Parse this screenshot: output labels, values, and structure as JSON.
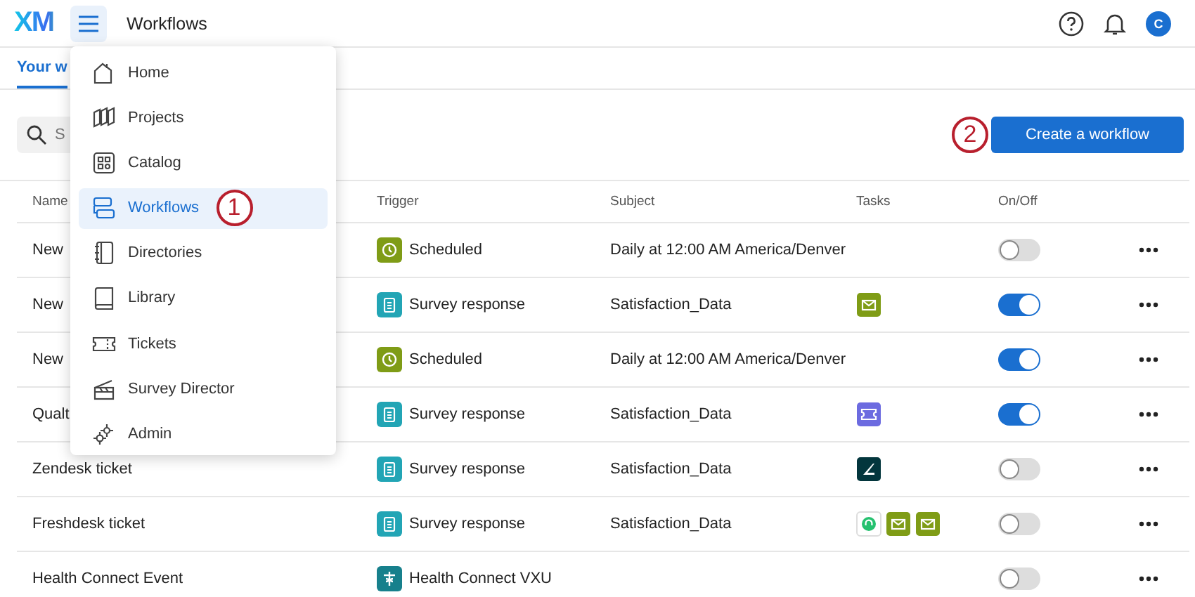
{
  "header": {
    "logo": "XM",
    "title": "Workflows",
    "avatar": "C"
  },
  "tabs": [
    {
      "label": "Your w",
      "selected": true
    }
  ],
  "search": {
    "placeholder": "S"
  },
  "create_button": {
    "label": "Create a workflow",
    "step": "2"
  },
  "table": {
    "columns": [
      "Name",
      "Trigger",
      "Subject",
      "Tasks",
      "On/Off"
    ],
    "rows": [
      {
        "name": "New",
        "trigger": {
          "kind": "scheduled",
          "label": "Scheduled"
        },
        "subject": "Daily at 12:00 AM America/Denver",
        "tasks": [],
        "on": false
      },
      {
        "name": "New",
        "trigger": {
          "kind": "survey",
          "label": "Survey response"
        },
        "subject": "Satisfaction_Data",
        "tasks": [
          {
            "kind": "email"
          }
        ],
        "on": true
      },
      {
        "name": "New",
        "trigger": {
          "kind": "scheduled",
          "label": "Scheduled"
        },
        "subject": "Daily at 12:00 AM America/Denver",
        "tasks": [],
        "on": true
      },
      {
        "name": "Qualt",
        "trigger": {
          "kind": "survey",
          "label": "Survey response"
        },
        "subject": "Satisfaction_Data",
        "tasks": [
          {
            "kind": "ticket"
          }
        ],
        "on": true
      },
      {
        "name": "Zendesk ticket",
        "trigger": {
          "kind": "survey",
          "label": "Survey response"
        },
        "subject": "Satisfaction_Data",
        "tasks": [
          {
            "kind": "zendesk"
          }
        ],
        "on": false
      },
      {
        "name": "Freshdesk ticket",
        "trigger": {
          "kind": "survey",
          "label": "Survey response"
        },
        "subject": "Satisfaction_Data",
        "tasks": [
          {
            "kind": "freshdesk"
          },
          {
            "kind": "email"
          },
          {
            "kind": "email"
          }
        ],
        "on": false
      },
      {
        "name": "Health Connect Event",
        "trigger": {
          "kind": "health",
          "label": "Health Connect VXU"
        },
        "tasks": [],
        "on": false
      }
    ]
  },
  "menu": {
    "items": [
      {
        "label": "Home",
        "selected": false
      },
      {
        "label": "Projects",
        "selected": false
      },
      {
        "label": "Catalog",
        "selected": false
      },
      {
        "label": "Workflows",
        "selected": true,
        "step": "1"
      },
      {
        "label": "Directories",
        "selected": false
      },
      {
        "label": "Library",
        "selected": false
      },
      {
        "label": "Tickets",
        "selected": false
      },
      {
        "label": "Survey Director",
        "selected": false
      },
      {
        "label": "Admin",
        "selected": false
      }
    ]
  }
}
